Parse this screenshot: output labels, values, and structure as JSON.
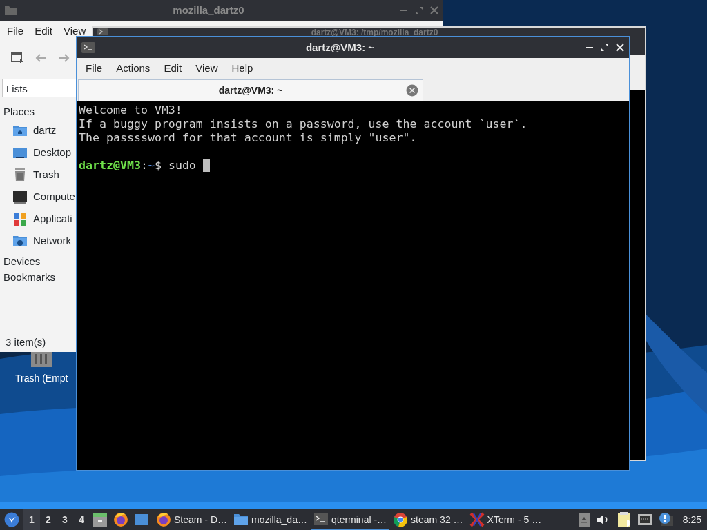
{
  "desktop": {
    "icons": [
      {
        "label": "Trash (Empt"
      }
    ]
  },
  "file_manager": {
    "title": "mozilla_dartz0",
    "menu": [
      "File",
      "Edit",
      "View"
    ],
    "sidebar": {
      "view": "Lists",
      "sections": [
        {
          "title": "Places",
          "items": [
            "dartz",
            "Desktop",
            "Trash",
            "Compute",
            "Applicati",
            "Network"
          ]
        },
        {
          "title": "Devices"
        },
        {
          "title": "Bookmarks"
        }
      ]
    },
    "status_bar": "3 item(s)"
  },
  "back_terminal": {
    "title": "dartz@VM3: /tmp/mozilla_dartz0"
  },
  "terminal": {
    "title": "dartz@VM3: ~",
    "menu": [
      "File",
      "Actions",
      "Edit",
      "View",
      "Help"
    ],
    "tabs": [
      {
        "label": "dartz@VM3: ~",
        "selected": true
      }
    ],
    "lines": [
      "Welcome to VM3!",
      "If a buggy program insists on a password, use the account `user`.",
      "The passssword for that account is simply \"user\"."
    ],
    "prompt": {
      "user_host": "dartz@VM3",
      "separator": ":",
      "path": "~",
      "symbol": "$",
      "command": "sudo"
    }
  },
  "taskbar": {
    "workspaces": [
      {
        "label": "1",
        "selected": true
      },
      {
        "label": "2",
        "selected": false
      },
      {
        "label": "3",
        "selected": false
      },
      {
        "label": "4",
        "selected": false
      }
    ],
    "tasks": [
      {
        "label": "Steam - D…",
        "selected": false
      },
      {
        "label": "mozilla_da…",
        "selected": false
      },
      {
        "label": "qterminal -…",
        "selected": true
      },
      {
        "label": "steam 32 …",
        "selected": false
      },
      {
        "label": "XTerm - 5 …",
        "selected": false
      }
    ],
    "clock": "8:25"
  }
}
